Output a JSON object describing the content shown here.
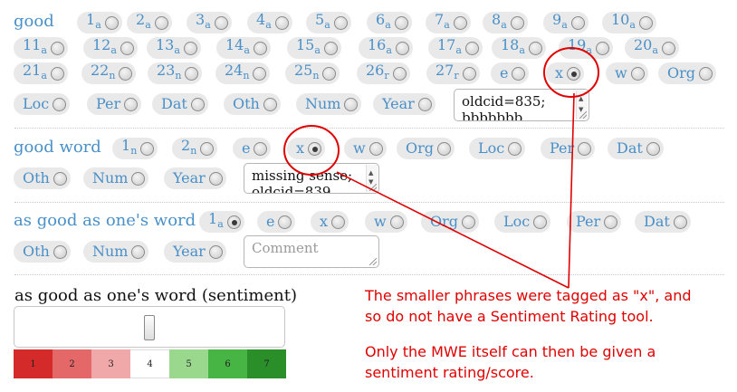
{
  "groups": [
    {
      "heading": "good",
      "options": [
        {
          "label": "1",
          "sub": "a",
          "selected": false
        },
        {
          "label": "2",
          "sub": "a",
          "selected": false
        },
        {
          "label": "3",
          "sub": "a",
          "selected": false
        },
        {
          "label": "4",
          "sub": "a",
          "selected": false
        },
        {
          "label": "5",
          "sub": "a",
          "selected": false
        },
        {
          "label": "6",
          "sub": "a",
          "selected": false
        },
        {
          "label": "7",
          "sub": "a",
          "selected": false
        },
        {
          "label": "8",
          "sub": "a",
          "selected": false
        },
        {
          "label": "9",
          "sub": "a",
          "selected": false
        },
        {
          "label": "10",
          "sub": "a",
          "selected": false
        },
        {
          "label": "11",
          "sub": "a",
          "selected": false
        },
        {
          "label": "12",
          "sub": "a",
          "selected": false
        },
        {
          "label": "13",
          "sub": "a",
          "selected": false
        },
        {
          "label": "14",
          "sub": "a",
          "selected": false
        },
        {
          "label": "15",
          "sub": "a",
          "selected": false
        },
        {
          "label": "16",
          "sub": "a",
          "selected": false
        },
        {
          "label": "17",
          "sub": "a",
          "selected": false
        },
        {
          "label": "18",
          "sub": "a",
          "selected": false
        },
        {
          "label": "19",
          "sub": "a",
          "selected": false
        },
        {
          "label": "20",
          "sub": "a",
          "selected": false
        },
        {
          "label": "21",
          "sub": "a",
          "selected": false
        },
        {
          "label": "22",
          "sub": "n",
          "selected": false
        },
        {
          "label": "23",
          "sub": "n",
          "selected": false
        },
        {
          "label": "24",
          "sub": "n",
          "selected": false
        },
        {
          "label": "25",
          "sub": "n",
          "selected": false
        },
        {
          "label": "26",
          "sub": "r",
          "selected": false
        },
        {
          "label": "27",
          "sub": "r",
          "selected": false
        },
        {
          "label": "e",
          "sub": "",
          "selected": false
        },
        {
          "label": "x",
          "sub": "",
          "selected": true
        },
        {
          "label": "w",
          "sub": "",
          "selected": false
        },
        {
          "label": "Org",
          "sub": "",
          "selected": false
        },
        {
          "label": "Loc",
          "sub": "",
          "selected": false
        },
        {
          "label": "Per",
          "sub": "",
          "selected": false
        },
        {
          "label": "Dat",
          "sub": "",
          "selected": false
        },
        {
          "label": "Oth",
          "sub": "",
          "selected": false
        },
        {
          "label": "Num",
          "sub": "",
          "selected": false
        },
        {
          "label": "Year",
          "sub": "",
          "selected": false
        }
      ],
      "comment": "oldcid=835;\nbbbbbbb"
    },
    {
      "heading": "good word",
      "options": [
        {
          "label": "1",
          "sub": "n",
          "selected": false
        },
        {
          "label": "2",
          "sub": "n",
          "selected": false
        },
        {
          "label": "e",
          "sub": "",
          "selected": false
        },
        {
          "label": "x",
          "sub": "",
          "selected": true
        },
        {
          "label": "w",
          "sub": "",
          "selected": false
        },
        {
          "label": "Org",
          "sub": "",
          "selected": false
        },
        {
          "label": "Loc",
          "sub": "",
          "selected": false
        },
        {
          "label": "Per",
          "sub": "",
          "selected": false
        },
        {
          "label": "Dat",
          "sub": "",
          "selected": false
        },
        {
          "label": "Oth",
          "sub": "",
          "selected": false
        },
        {
          "label": "Num",
          "sub": "",
          "selected": false
        },
        {
          "label": "Year",
          "sub": "",
          "selected": false
        }
      ],
      "comment": "missing sense;\noldcid=839"
    },
    {
      "heading": "as good as one's word",
      "options": [
        {
          "label": "1",
          "sub": "a",
          "selected": true
        },
        {
          "label": "e",
          "sub": "",
          "selected": false
        },
        {
          "label": "x",
          "sub": "",
          "selected": false
        },
        {
          "label": "w",
          "sub": "",
          "selected": false
        },
        {
          "label": "Org",
          "sub": "",
          "selected": false
        },
        {
          "label": "Loc",
          "sub": "",
          "selected": false
        },
        {
          "label": "Per",
          "sub": "",
          "selected": false
        },
        {
          "label": "Dat",
          "sub": "",
          "selected": false
        },
        {
          "label": "Oth",
          "sub": "",
          "selected": false
        },
        {
          "label": "Num",
          "sub": "",
          "selected": false
        },
        {
          "label": "Year",
          "sub": "",
          "selected": false
        }
      ],
      "comment": "",
      "comment_placeholder": "Comment"
    }
  ],
  "sentiment": {
    "title": "as good as one's word (sentiment)",
    "value": 4,
    "scale": [
      {
        "label": "1",
        "color": "#d42a2a"
      },
      {
        "label": "2",
        "color": "#e46868"
      },
      {
        "label": "3",
        "color": "#f0a8a8"
      },
      {
        "label": "4",
        "color": "#ffffff"
      },
      {
        "label": "5",
        "color": "#9ad88e"
      },
      {
        "label": "6",
        "color": "#46b544"
      },
      {
        "label": "7",
        "color": "#2a8f28"
      }
    ]
  },
  "annotation": {
    "color": "#e00000",
    "lines": [
      "The smaller phrases were tagged as \"x\", and",
      "so do not have a Sentiment Rating tool.",
      "",
      "Only the MWE itself can then be given a",
      "sentiment rating/score."
    ]
  }
}
